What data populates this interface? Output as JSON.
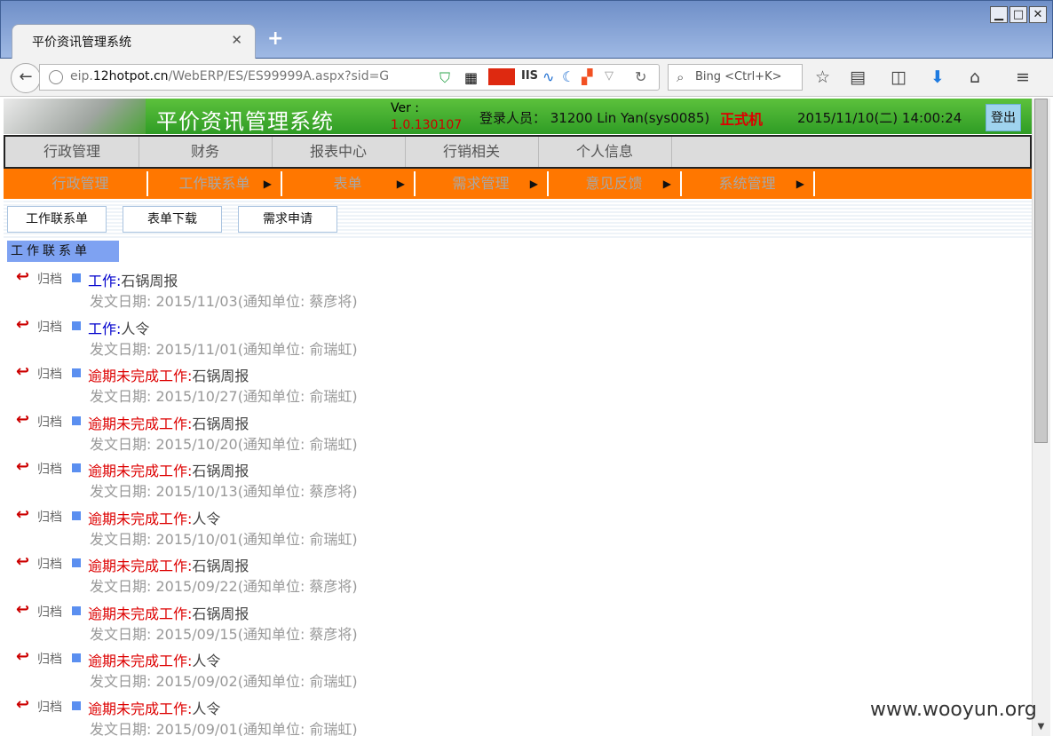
{
  "browser": {
    "tab_title": "平价资讯管理系统",
    "url_prefix": "eip.",
    "url_domain": "12hotpot.cn",
    "url_path": "/WebERP/ES/ES99999A.aspx?sid=G",
    "search_placeholder": "Bing <Ctrl+K>",
    "ext_iis": "IIS"
  },
  "header": {
    "system_name": "平价资讯管理系统",
    "ver_label": "Ver :",
    "ver_number": "1.0.130107",
    "login_info": "登录人员： 31200 Lin Yan(sys0085)",
    "env_label": "正式机",
    "datetime": "2015/11/10(二) 14:00:24",
    "logout": "登出"
  },
  "main_menu": [
    "行政管理",
    "财务",
    "报表中心",
    "行销相关",
    "个人信息"
  ],
  "sub_menu": [
    {
      "label": "行政管理",
      "arrow": false
    },
    {
      "label": "工作联系单",
      "arrow": true
    },
    {
      "label": "表单",
      "arrow": true
    },
    {
      "label": "需求管理",
      "arrow": true
    },
    {
      "label": "意见反馈",
      "arrow": true
    },
    {
      "label": "系统管理",
      "arrow": true
    }
  ],
  "buttons": [
    "工作联系单",
    "表单下载",
    "需求申请"
  ],
  "section_title": "工作联系单",
  "archive_label": "归档",
  "items": [
    {
      "kind": "工作:",
      "kind_color": "blue",
      "title": "石锅周报",
      "meta": "发文日期: 2015/11/03(通知单位: 蔡彦将)"
    },
    {
      "kind": "工作:",
      "kind_color": "blue",
      "title": "人令",
      "meta": "发文日期: 2015/11/01(通知单位: 俞瑞虹)"
    },
    {
      "kind": "逾期未完成工作:",
      "kind_color": "red",
      "title": "石锅周报",
      "meta": "发文日期: 2015/10/27(通知单位: 俞瑞虹)"
    },
    {
      "kind": "逾期未完成工作:",
      "kind_color": "red",
      "title": "石锅周报",
      "meta": "发文日期: 2015/10/20(通知单位: 俞瑞虹)"
    },
    {
      "kind": "逾期未完成工作:",
      "kind_color": "red",
      "title": "石锅周报",
      "meta": "发文日期: 2015/10/13(通知单位: 蔡彦将)"
    },
    {
      "kind": "逾期未完成工作:",
      "kind_color": "red",
      "title": "人令",
      "meta": "发文日期: 2015/10/01(通知单位: 俞瑞虹)"
    },
    {
      "kind": "逾期未完成工作:",
      "kind_color": "red",
      "title": "石锅周报",
      "meta": "发文日期: 2015/09/22(通知单位: 蔡彦将)"
    },
    {
      "kind": "逾期未完成工作:",
      "kind_color": "red",
      "title": "石锅周报",
      "meta": "发文日期: 2015/09/15(通知单位: 蔡彦将)"
    },
    {
      "kind": "逾期未完成工作:",
      "kind_color": "red",
      "title": "人令",
      "meta": "发文日期: 2015/09/02(通知单位: 俞瑞虹)"
    },
    {
      "kind": "逾期未完成工作:",
      "kind_color": "red",
      "title": "人令",
      "meta": "发文日期: 2015/09/01(通知单位: 俞瑞虹)"
    }
  ],
  "watermark": "www.wooyun.org",
  "colors": {
    "header_green": "#3aa82c",
    "submenu_orange": "#ff7700",
    "section_blue": "#7ea2f2",
    "env_red": "#dd0000"
  }
}
